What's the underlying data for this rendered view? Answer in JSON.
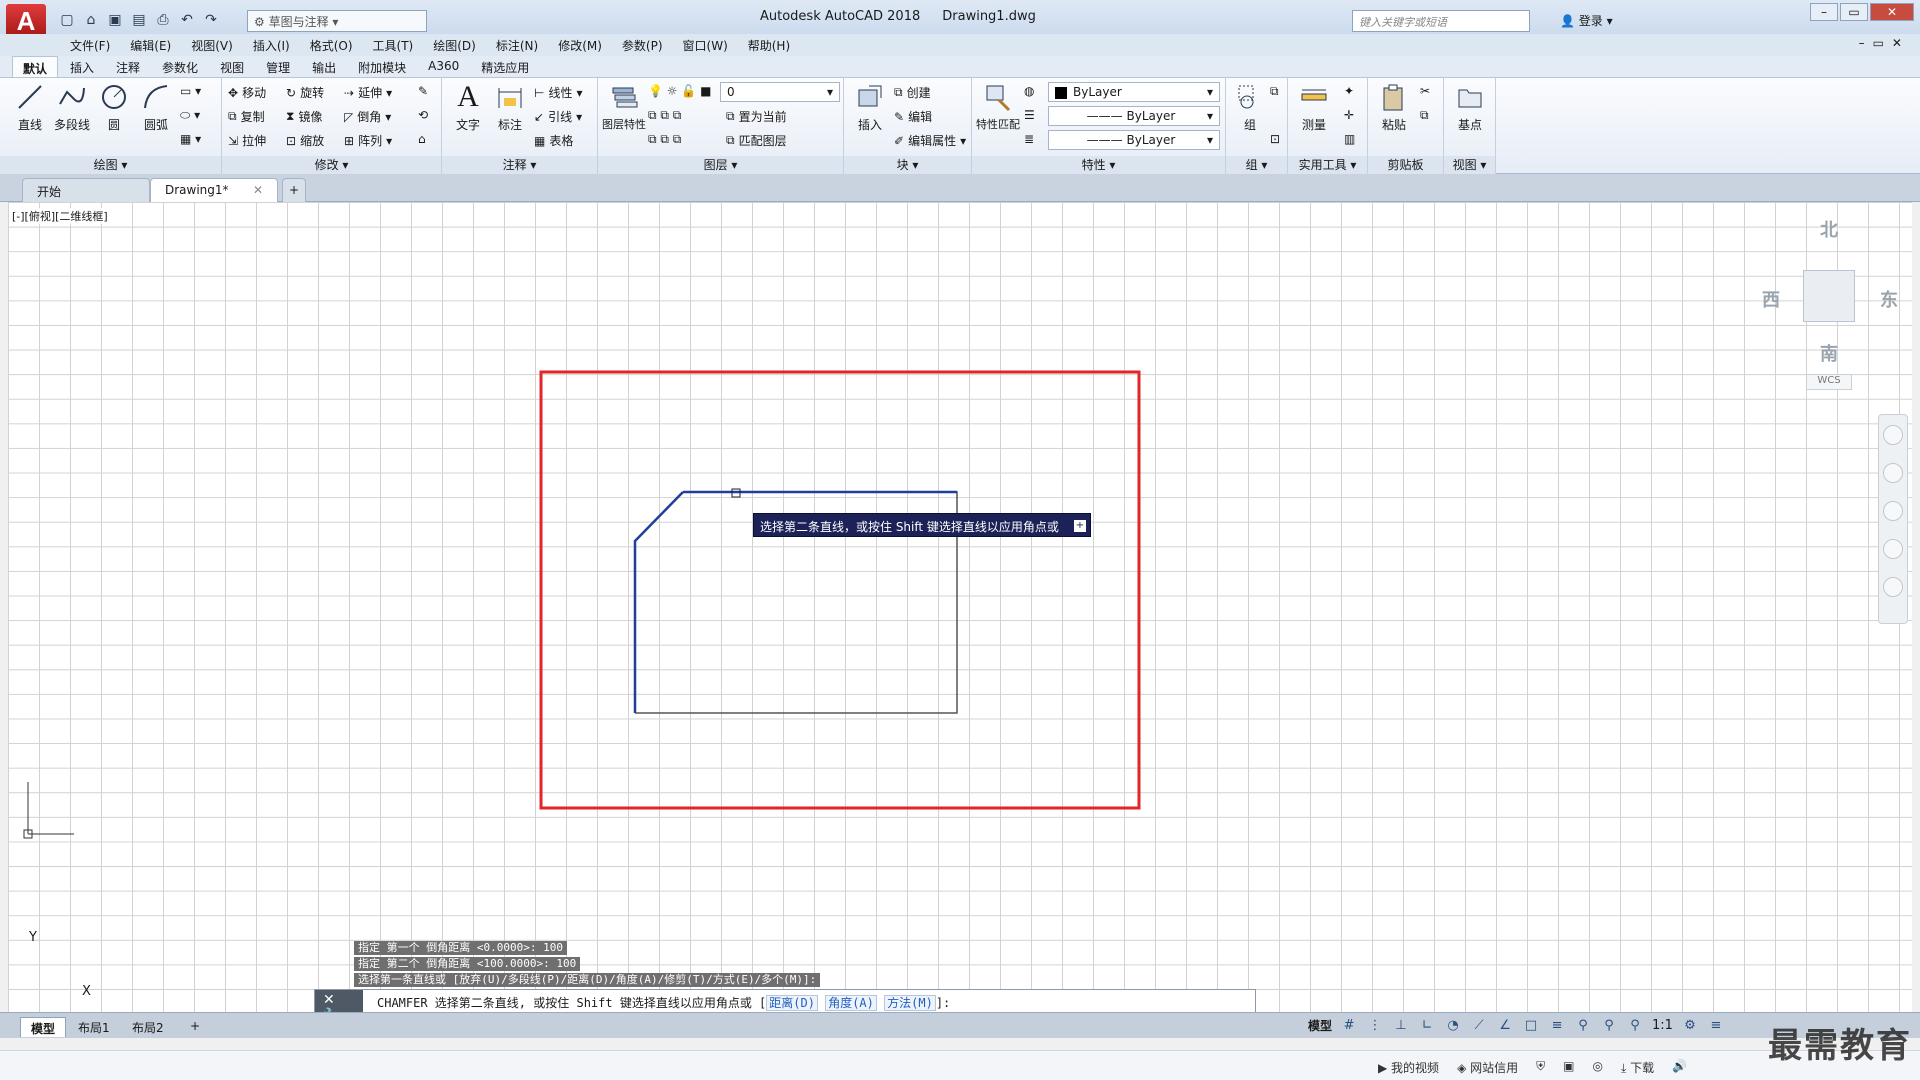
{
  "titlebar": {
    "app_name": "Autodesk AutoCAD 2018",
    "file_name": "Drawing1.dwg",
    "logo_letter": "A",
    "workspace": "草图与注释",
    "search_placeholder": "键入关键字或短语",
    "login": "登录"
  },
  "menubar": [
    "文件(F)",
    "编辑(E)",
    "视图(V)",
    "插入(I)",
    "格式(O)",
    "工具(T)",
    "绘图(D)",
    "标注(N)",
    "修改(M)",
    "参数(P)",
    "窗口(W)",
    "帮助(H)"
  ],
  "ribbon_tabs": [
    "默认",
    "插入",
    "注释",
    "参数化",
    "视图",
    "管理",
    "输出",
    "附加模块",
    "A360",
    "精选应用"
  ],
  "ribbon": {
    "draw": {
      "title": "绘图",
      "line": "直线",
      "polyline": "多段线",
      "circle": "圆",
      "arc": "圆弧"
    },
    "modify": {
      "title": "修改",
      "move": "移动",
      "rotate": "旋转",
      "extend": "延伸",
      "copy": "复制",
      "mirror": "镜像",
      "chamfer": "倒角",
      "stretch": "拉伸",
      "scale": "缩放",
      "array": "阵列"
    },
    "annotation": {
      "title": "注释",
      "text": "文字",
      "dimension": "标注",
      "linear": "线性",
      "leader": "引线",
      "table": "表格"
    },
    "layers": {
      "title": "图层",
      "layer_props": "图层特性",
      "current_layer": "0",
      "set_current": "置为当前",
      "match_layer": "匹配图层"
    },
    "block": {
      "title": "块",
      "insert": "插入",
      "create": "创建",
      "edit": "编辑",
      "edit_attr": "编辑属性"
    },
    "properties": {
      "title": "特性",
      "match": "特性匹配",
      "color": "ByLayer",
      "linetype": "ByLayer",
      "lineweight": "ByLayer"
    },
    "groups": {
      "title": "组",
      "group": "组"
    },
    "utilities": {
      "title": "实用工具",
      "measure": "测量"
    },
    "clipboard": {
      "title": "剪贴板",
      "paste": "粘贴"
    },
    "view": {
      "title": "视图",
      "base": "基点"
    }
  },
  "file_tabs": {
    "start": "开始",
    "drawing": "Drawing1*"
  },
  "viewport_label": "[-][俯视][二维线框]",
  "viewcube": {
    "north": "北",
    "south": "南",
    "east": "东",
    "west": "西",
    "wcs": "WCS"
  },
  "tooltip": "选择第二条直线，或按住 Shift 键选择直线以应用角点或",
  "ucs": {
    "x": "X",
    "y": "Y"
  },
  "command_history": [
    "指定 第一个 倒角距离 <0.0000>: 100",
    "指定 第二个 倒角距离 <100.0000>: 100",
    "选择第一条直线或 [放弃(U)/多段线(P)/距离(D)/角度(A)/修剪(T)/方式(E)/多个(M)]:"
  ],
  "command_line": {
    "prefix": "CHAMFER 选择第二条直线, 或按住 Shift 键选择直线以应用角点或 [",
    "opt1": "距离(D)",
    "opt2": "角度(A)",
    "opt3": "方法(M)",
    "suffix": "]:"
  },
  "layout_tabs": [
    "模型",
    "布局1",
    "布局2"
  ],
  "status": {
    "model": "模型",
    "scale": "1:1"
  },
  "os_bar": {
    "my_video": "我的视频",
    "credit": "网站信用",
    "download": "下载"
  },
  "watermark": "最需教育",
  "colors": {
    "highlight_rect": "#e0262a",
    "selected_line": "#1f3f9a",
    "tooltip_bg": "#1c2257"
  }
}
